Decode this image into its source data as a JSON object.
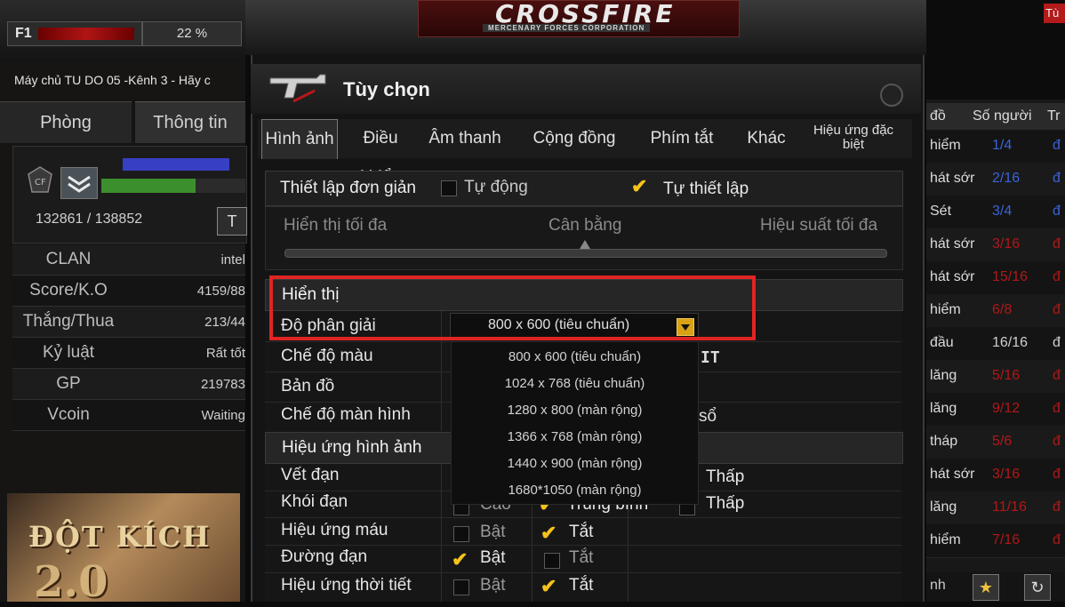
{
  "left": {
    "f1": "F1",
    "percent": "22 %",
    "server": "Máy chủ TU DO 05 -Kênh 3 - Hãy c",
    "tabs": [
      "Phòng",
      "Thông tin"
    ],
    "username": "____________",
    "exp": "132861 / 138852",
    "t_button": "T",
    "stats": [
      {
        "k": "CLAN",
        "v": "intel"
      },
      {
        "k": "Score/K.O",
        "v": "4159/88"
      },
      {
        "k": "Thắng/Thua",
        "v": "213/44"
      },
      {
        "k": "Kỷ luật",
        "v": "Rất tốt"
      },
      {
        "k": "GP",
        "v": "219783"
      },
      {
        "k": "Vcoin",
        "v": "Waiting"
      }
    ],
    "logo_text": "ĐỘT KÍCH",
    "logo_num": "2.0"
  },
  "header": {
    "brand": "CROSSFIRE",
    "tagline": "MERCENARY FORCES CORPORATION"
  },
  "dialog": {
    "title": "Tùy chọn",
    "tabs": [
      "Hình ảnh",
      "Điều khiển",
      "Âm thanh",
      "Cộng đồng",
      "Phím tắt",
      "Khác",
      "Hiệu ứng đặc biệt"
    ],
    "simple": {
      "label": "Thiết lập đơn giản",
      "auto": "Tự động",
      "custom": "Tự thiết lập",
      "slider": [
        "Hiển thị tối đa",
        "Cân bằng",
        "Hiệu suất tối đa"
      ]
    },
    "display": {
      "header": "Hiển thị",
      "resolution_label": "Độ phân giải",
      "resolution_value": "800 x 600 (tiêu chuẩn)",
      "color_mode": "Chế độ màu",
      "map": "Bản đồ",
      "screen_mode": "Chế độ màn hình",
      "partial_right_1": "IT",
      "partial_right_2": "sổ",
      "options": [
        "800 x 600 (tiêu chuẩn)",
        "1024 x 768 (tiêu chuẩn)",
        "1280 x 800 (màn rộng)",
        "1366 x 768 (màn rộng)",
        "1440 x 900 (màn rộng)",
        "1680*1050 (màn rộng)"
      ]
    },
    "effects": {
      "header": "Hiệu ứng hình ảnh",
      "rows": [
        {
          "label": "Vết đạn",
          "o1": "",
          "o2": "",
          "o3": "Thấp"
        },
        {
          "label": "Khói đạn",
          "o1": "Cao",
          "o2": "Trung bình",
          "o3": "Thấp"
        },
        {
          "label": "Hiệu ứng máu",
          "o1": "Bật",
          "o2": "Tắt",
          "o3": ""
        },
        {
          "label": "Đường đạn",
          "o1": "Bật",
          "o2": "Tắt",
          "o3": ""
        },
        {
          "label": "Hiệu ứng thời tiết",
          "o1": "Bật",
          "o2": "Tắt",
          "o3": ""
        }
      ]
    }
  },
  "right": {
    "top_btn": "Tù",
    "headers": [
      "đồ",
      "Số người",
      "Tr"
    ],
    "rows": [
      {
        "name": "hiểm",
        "count": "1/4",
        "color": "#3b63d8"
      },
      {
        "name": "hát sớr",
        "count": "2/16",
        "color": "#3b63d8"
      },
      {
        "name": "Sét",
        "count": "3/4",
        "color": "#3b63d8"
      },
      {
        "name": "hát sớr",
        "count": "3/16",
        "color": "#b01818"
      },
      {
        "name": "hát sớr",
        "count": "15/16",
        "color": "#b01818"
      },
      {
        "name": "hiểm",
        "count": "6/8",
        "color": "#b01818"
      },
      {
        "name": "đầu",
        "count": "16/16",
        "color": "#cfcfcf"
      },
      {
        "name": "lăng",
        "count": "5/16",
        "color": "#b01818"
      },
      {
        "name": "lăng",
        "count": "9/12",
        "color": "#b01818"
      },
      {
        "name": "tháp",
        "count": "5/6",
        "color": "#b01818"
      },
      {
        "name": "hát sớr",
        "count": "3/16",
        "color": "#b01818"
      },
      {
        "name": "lăng",
        "count": "11/16",
        "color": "#b01818"
      },
      {
        "name": "hiểm",
        "count": "7/16",
        "color": "#b01818"
      }
    ],
    "bottom": "nh"
  },
  "colors": {
    "accent_red": "#e02424",
    "check_yellow": "#f4c21a"
  }
}
